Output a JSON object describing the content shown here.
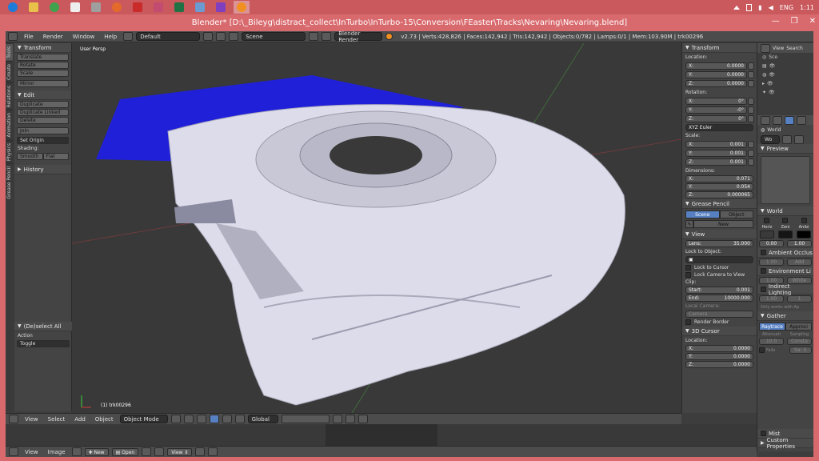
{
  "taskbar": {
    "apps": [
      {
        "icon": "ie-icon",
        "color": "#1f7bd8"
      },
      {
        "icon": "file-explorer-icon",
        "color": "#e8c04a"
      },
      {
        "icon": "chrome-icon",
        "color": "#3fa34d"
      },
      {
        "icon": "code-icon",
        "color": "#eeeeee"
      },
      {
        "icon": "app-icon",
        "color": "#9f9f9f"
      },
      {
        "icon": "firefox-icon",
        "color": "#e46a2b"
      },
      {
        "icon": "acrobat-icon",
        "color": "#c92a2a"
      },
      {
        "icon": "paint-icon",
        "color": "#c24b72"
      },
      {
        "icon": "excel-icon",
        "color": "#207245"
      },
      {
        "icon": "notepad-icon",
        "color": "#6b9bd1"
      },
      {
        "icon": "color-icon",
        "color": "#7f3fbf"
      },
      {
        "icon": "blender-icon",
        "color": "#f19022"
      }
    ],
    "language": "ENG",
    "time": "1:11"
  },
  "window": {
    "title": "Blender* [D:\\_Bileyg\\distract_collect\\InTurbo\\InTurbo-15\\Conversion\\FEaster\\Tracks\\Nevaring\\Nevaring.blend]",
    "minimize": "—",
    "maximize": "❐",
    "close": "✕"
  },
  "info_header": {
    "menu": [
      "File",
      "Render",
      "Window",
      "Help"
    ],
    "screen_layout": "Default",
    "scene": "Scene",
    "render_engine": "Blender Render",
    "stats": "v2.73 | Verts:428,826 | Faces:142,942 | Tris:142,942 | Objects:0/782 | Lamps:0/1 | Mem:103.90M | trk00296"
  },
  "tool_tabs": [
    "Tools",
    "Create",
    "Relations",
    "Animation",
    "Physics",
    "Grease Pencil"
  ],
  "toolshelf": {
    "transform_header": "Transform",
    "transform_buttons": [
      "Translate",
      "Rotate",
      "Scale"
    ],
    "mirror": "Mirror",
    "edit_header": "Edit",
    "edit_buttons": [
      "Duplicate",
      "Duplicate Linked",
      "Delete"
    ],
    "join": "Join",
    "set_origin": "Set Origin",
    "shading_label": "Shading:",
    "smooth": "Smooth",
    "flat": "Flat",
    "history_header": "History",
    "operator_header": "(De)select All",
    "action_label": "Action",
    "action_value": "Toggle"
  },
  "viewport": {
    "view_label": "User Persp",
    "object_label": "(1) trk00296"
  },
  "viewport_header": {
    "menu": [
      "View",
      "Select",
      "Add",
      "Object"
    ],
    "mode": "Object Mode",
    "orientation": "Global"
  },
  "npanel": {
    "transform_header": "Transform",
    "location_label": "Location:",
    "location": [
      {
        "axis": "X:",
        "value": "0.0000"
      },
      {
        "axis": "Y:",
        "value": "0.0000"
      },
      {
        "axis": "Z:",
        "value": "0.0000"
      }
    ],
    "rotation_label": "Rotation:",
    "rotation": [
      {
        "axis": "X:",
        "value": "0°"
      },
      {
        "axis": "Y:",
        "value": "-0°"
      },
      {
        "axis": "Z:",
        "value": "0°"
      }
    ],
    "rotation_mode": "XYZ Euler",
    "scale_label": "Scale:",
    "scale": [
      {
        "axis": "X:",
        "value": "0.001"
      },
      {
        "axis": "Y:",
        "value": "0.001"
      },
      {
        "axis": "Z:",
        "value": "0.001"
      }
    ],
    "dimensions_label": "Dimensions:",
    "dimensions": [
      {
        "axis": "X:",
        "value": "0.071"
      },
      {
        "axis": "Y:",
        "value": "0.054"
      },
      {
        "axis": "Z:",
        "value": "0.000065"
      }
    ],
    "grease_header": "Grease Pencil",
    "grease_scene": "Scene",
    "grease_object": "Object",
    "grease_new": "New",
    "view_header": "View",
    "lens_label": "Lens:",
    "lens_value": "35.000",
    "lock_object_label": "Lock to Object:",
    "lock_cursor": "Lock to Cursor",
    "lock_camera": "Lock Camera to View",
    "clip_label": "Clip:",
    "clip_start_label": "Start:",
    "clip_start": "0.001",
    "clip_end_label": "End:",
    "clip_end": "10000.000",
    "local_camera_label": "Local Camera:",
    "camera_value": "Camera",
    "render_border": "Render Border",
    "cursor_header": "3D Cursor",
    "cursor_location_label": "Location:",
    "cursor": [
      {
        "axis": "X:",
        "value": "0.0000"
      },
      {
        "axis": "Y:",
        "value": "0.0000"
      },
      {
        "axis": "Z:",
        "value": "0.0000"
      }
    ]
  },
  "outliner": {
    "view": "View",
    "search": "Search",
    "items": [
      "Sce",
      "",
      "",
      "",
      ""
    ]
  },
  "properties": {
    "world_label": "World",
    "world_name": "Wo",
    "preview_header": "Preview",
    "world_header": "World",
    "horiz": "Horiz",
    "zenith": "Zeni",
    "ambient": "Ambi",
    "val_a": "0.00",
    "val_b": "1.00",
    "ao_header": "Ambient Occlus",
    "ao_value": "1.00",
    "ao_mode": "Add",
    "env_header": "Environment Li",
    "env_value": "1.00",
    "env_color": "White",
    "indirect_header": "Indirect Lighting",
    "indirect_value": "1.00",
    "indirect_bounce": "1",
    "indirect_note": "Only works with Ap",
    "gather_header": "Gather",
    "raytrace": "Raytrace",
    "approx": "Approxi",
    "attenuation": "Attenuati",
    "sampling": "Sampling",
    "distance": "10.0",
    "constant": "Consta",
    "falloff": "Fallo",
    "samples": "Sa: 5",
    "mist_header": "Mist",
    "custom_header": "Custom Properties"
  },
  "image_editor": {
    "menu": [
      "View",
      "Image"
    ],
    "new": "New",
    "open": "Open",
    "view": "View"
  },
  "colors": {
    "taskbar": "#c9595c",
    "titlebar": "#d8696d",
    "blue_plane": "#2020d8",
    "track_surface": "#dcdcea",
    "selection_blue": "#5680c2"
  }
}
